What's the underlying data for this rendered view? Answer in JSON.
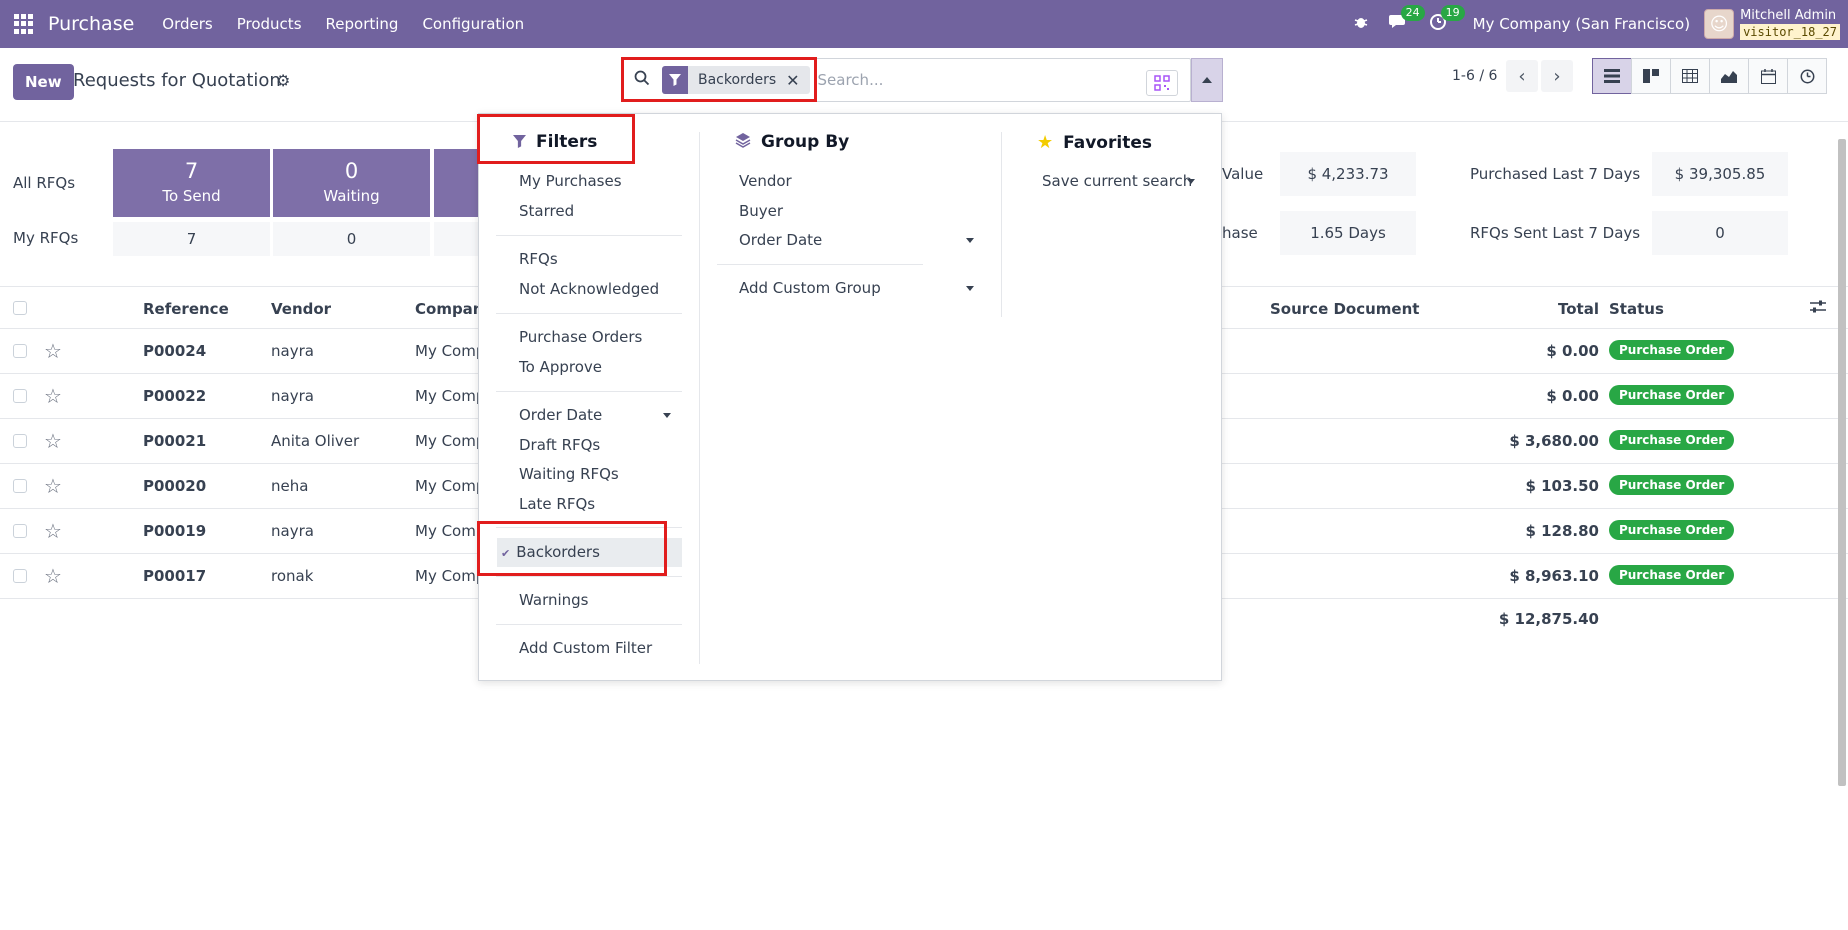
{
  "navbar": {
    "app_name": "Purchase",
    "menu": [
      "Orders",
      "Products",
      "Reporting",
      "Configuration"
    ],
    "messages_count": "24",
    "activities_count": "19",
    "company": "My Company (San Francisco)",
    "user_name": "Mitchell Admin",
    "db_name": "visitor_18_27",
    "bg_color": "#71639e"
  },
  "control": {
    "new_label": "New",
    "title": "Requests for Quotation",
    "facet_label": "Backorders",
    "search_placeholder": "Search...",
    "pager": "1-6 / 6"
  },
  "dashboard": {
    "all_label": "All RFQs",
    "my_label": "My RFQs",
    "tiles": [
      {
        "num": "7",
        "label": "To Send",
        "my": "7"
      },
      {
        "num": "0",
        "label": "Waiting",
        "my": "0"
      }
    ],
    "stats": [
      {
        "label": "Value",
        "value": "$ 4,233.73"
      },
      {
        "label": "hase",
        "value": "1.65 Days"
      },
      {
        "label": "Purchased Last 7 Days",
        "value": "$ 39,305.85"
      },
      {
        "label": "RFQs Sent Last 7 Days",
        "value": "0"
      }
    ]
  },
  "table": {
    "headers": {
      "reference": "Reference",
      "vendor": "Vendor",
      "company": "Company",
      "source": "Source Document",
      "total": "Total",
      "status": "Status"
    },
    "rows": [
      {
        "ref": "P00024",
        "vendor": "nayra",
        "company": "My Comp",
        "total": "$ 0.00",
        "status": "Purchase Order"
      },
      {
        "ref": "P00022",
        "vendor": "nayra",
        "company": "My Comp",
        "total": "$ 0.00",
        "status": "Purchase Order"
      },
      {
        "ref": "P00021",
        "vendor": "Anita Oliver",
        "company": "My Comp",
        "total": "$ 3,680.00",
        "status": "Purchase Order"
      },
      {
        "ref": "P00020",
        "vendor": "neha",
        "company": "My Comp",
        "total": "$ 103.50",
        "status": "Purchase Order"
      },
      {
        "ref": "P00019",
        "vendor": "nayra",
        "company": "My Comp",
        "total": "$ 128.80",
        "status": "Purchase Order"
      },
      {
        "ref": "P00017",
        "vendor": "ronak",
        "company": "My Comp",
        "total": "$ 8,963.10",
        "status": "Purchase Order"
      }
    ],
    "grand_total": "$ 12,875.40"
  },
  "dropdown": {
    "filters_title": "Filters",
    "groupby_title": "Group By",
    "favorites_title": "Favorites",
    "filters": {
      "my_purchases": "My Purchases",
      "starred": "Starred",
      "rfqs": "RFQs",
      "not_ack": "Not Acknowledged",
      "purchase_orders": "Purchase Orders",
      "to_approve": "To Approve",
      "order_date": "Order Date",
      "draft_rfqs": "Draft RFQs",
      "waiting_rfqs": "Waiting RFQs",
      "late_rfqs": "Late RFQs",
      "backorders": "Backorders",
      "warnings": "Warnings",
      "add_custom": "Add Custom Filter"
    },
    "groupby": {
      "vendor": "Vendor",
      "buyer": "Buyer",
      "order_date": "Order Date",
      "add_custom": "Add Custom Group"
    },
    "favorites": {
      "save_current": "Save current search"
    }
  }
}
